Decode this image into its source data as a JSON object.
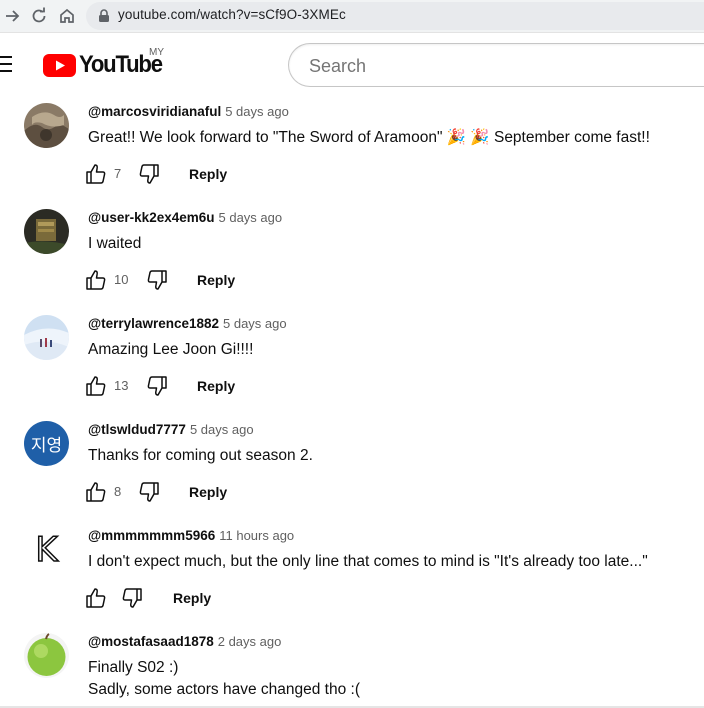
{
  "browser": {
    "url": "youtube.com/watch?v=sCf9O-3XMEc"
  },
  "masthead": {
    "logo_text": "YouTube",
    "region": "MY",
    "search_placeholder": "Search"
  },
  "comments": [
    {
      "author": "@marcosviridianaful",
      "time": "5 days ago",
      "text": "Great!! We look forward to \"The Sword of Aramoon\" 🎉 🎉 September come fast!!",
      "likes": "7",
      "reply_label": "Reply",
      "avatar": "photo-rock-landscape"
    },
    {
      "author": "@user-kk2ex4em6u",
      "time": "5 days ago",
      "text": "I waited",
      "likes": "10",
      "reply_label": "Reply",
      "avatar": "photo-dark-sign"
    },
    {
      "author": "@terrylawrence1882",
      "time": "5 days ago",
      "text": "Amazing Lee Joon Gi!!!!",
      "likes": "13",
      "reply_label": "Reply",
      "avatar": "photo-snow-hikers"
    },
    {
      "author": "@tlswldud7777",
      "time": "5 days ago",
      "text": "Thanks for coming out season 2.",
      "likes": "8",
      "reply_label": "Reply",
      "avatar_text": "지영",
      "avatar_color": "#1f5fa8"
    },
    {
      "author": "@mmmmmmm5966",
      "time": "11 hours ago",
      "text": "I don't expect much, but the only line that comes to mind is \"It's already too late...\"",
      "likes": "",
      "reply_label": "Reply",
      "avatar_text": "K",
      "avatar_color": "#ffffff"
    },
    {
      "author": "@mostafasaad1878",
      "time": "2 days ago",
      "text": "Finally S02 :)",
      "text2": "Sadly, some actors have changed tho :(",
      "avatar": "photo-green-apple"
    }
  ]
}
